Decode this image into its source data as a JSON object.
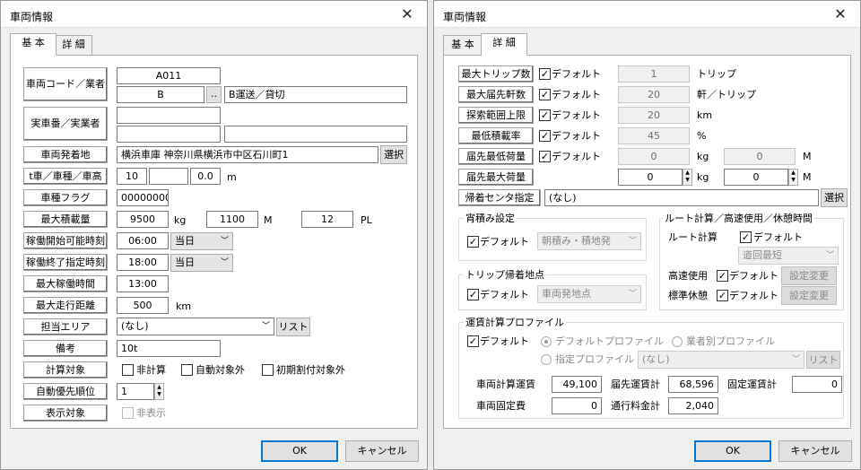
{
  "left": {
    "title": "車両情報",
    "tabs": [
      "基 本",
      "詳 細"
    ],
    "vehicle_code_label": "車両コード／業者",
    "vehicle_code": "A011",
    "company_code": "B",
    "company_btn": "..",
    "company_name": "B運送／貸切",
    "real_no_label": "実車番／実業者",
    "real_no": "",
    "real_company_code": "",
    "real_company_name": "",
    "depot_label": "車両発着地",
    "depot": "横浜車庫 神奈川県横浜市中区石川町1",
    "select_btn": "選択",
    "size_label": "t車／車種／車高",
    "ton": "10",
    "vtype": "",
    "height": "0.0",
    "height_unit": "m",
    "flag_label": "車種フラグ",
    "flag": "00000000",
    "max_load_label": "最大積載量",
    "kg_val": "9500",
    "kg": "kg",
    "m_val": "1100",
    "m": "M",
    "pl_val": "12",
    "pl": "PL",
    "start_label": "稼働開始可能時刻",
    "start_time": "06:00",
    "start_day": "当日",
    "end_label": "稼働終了指定時刻",
    "end_time": "18:00",
    "end_day": "当日",
    "max_hours_label": "最大稼働時間",
    "max_hours": "13:00",
    "max_dist_label": "最大走行距離",
    "max_dist": "500",
    "km": "km",
    "area_label": "担当エリア",
    "area": "(なし)",
    "list_btn": "リスト",
    "note_label": "備考",
    "note": "10t",
    "calc_label": "計算対象",
    "cb_nocalc": "非計算",
    "cb_autoexcl": "自動対象外",
    "cb_initexcl": "初期割付対象外",
    "priority_label": "自動優先順位",
    "priority": "1",
    "display_label": "表示対象",
    "cb_hide": "非表示",
    "ok": "OK",
    "cancel": "キャンセル"
  },
  "right": {
    "title": "車両情報",
    "tabs": [
      "基 本",
      "詳 細"
    ],
    "trip_label": "最大トリップ数",
    "default": "デフォルト",
    "trip_val": "1",
    "trip_unit": "トリップ",
    "stops_label": "最大届先軒数",
    "stops_val": "20",
    "stops_unit": "軒／トリップ",
    "range_label": "探索範囲上限",
    "range_val": "20",
    "range_unit": "km",
    "minrate_label": "最低積載率",
    "minrate_val": "45",
    "minrate_unit": "%",
    "minload_label": "届先最低荷量",
    "minload_kg": "0",
    "kg": "kg",
    "minload_m": "0",
    "m": "M",
    "maxload_label": "届先最大荷量",
    "maxload_kg": "0",
    "maxload_m": "0",
    "center_label": "帰着センタ指定",
    "center": "(なし)",
    "select_btn": "選択",
    "loading_group": "宵積み設定",
    "loading_sel": "朝積み・積地発",
    "return_group": "トリップ帰着地点",
    "return_sel": "車両発地点",
    "route_group": "ルート計算／高速使用／休憩時間",
    "route_label": "ルート計算",
    "route_sel": "道回最短",
    "highway_label": "高速使用",
    "rest_label": "標準休憩",
    "change_btn": "設定変更",
    "fare_group": "運賃計算プロファイル",
    "radio_default": "デフォルトプロファイル",
    "radio_company": "業者別プロファイル",
    "radio_custom": "指定プロファイル",
    "profile_sel": "(なし)",
    "list_btn": "リスト",
    "fare_vehicle_label": "車両計算運賃",
    "fare_vehicle": "49,100",
    "fare_dest_label": "届先運賃計",
    "fare_dest": "68,596",
    "fare_fixed_label": "固定運賃計",
    "fare_fixed": "0",
    "fixed_cost_label": "車両固定費",
    "fixed_cost": "0",
    "toll_label": "通行料金計",
    "toll": "2,040",
    "ok": "OK",
    "cancel": "キャンセル"
  }
}
